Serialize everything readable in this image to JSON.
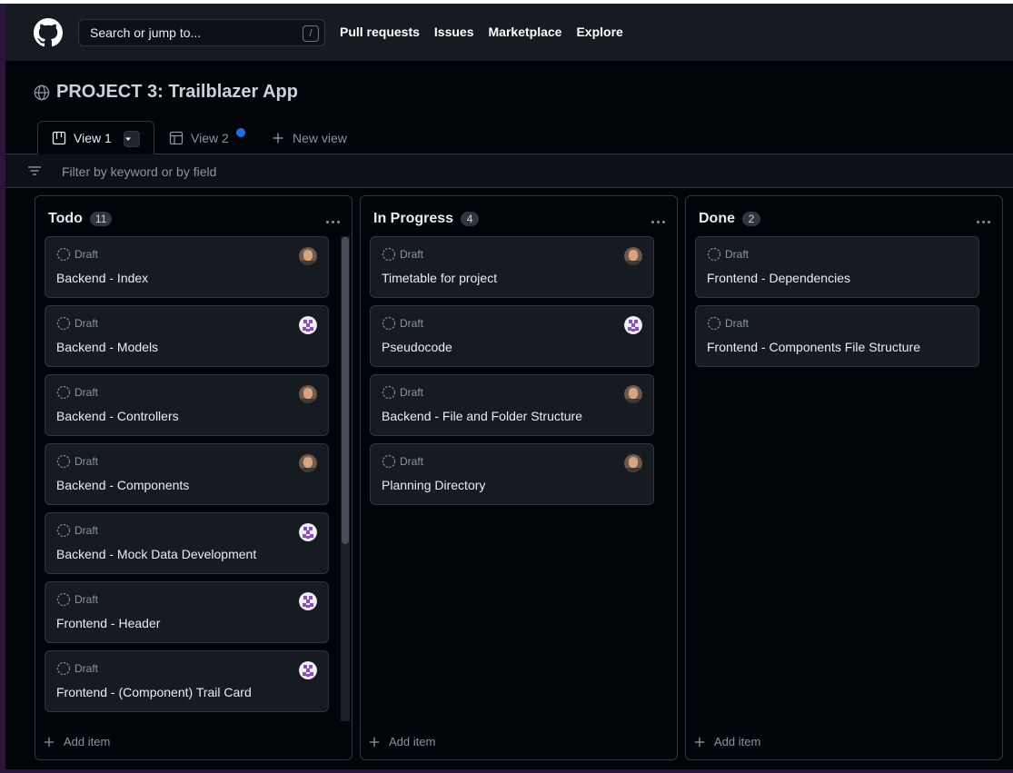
{
  "header": {
    "search_placeholder": "Search or jump to...",
    "search_key": "/",
    "nav": [
      "Pull requests",
      "Issues",
      "Marketplace",
      "Explore"
    ]
  },
  "project": {
    "title": "PROJECT 3: Trailblazer App"
  },
  "tabs": {
    "view1": "View 1",
    "view2": "View 2",
    "new_view": "New view"
  },
  "filter": {
    "placeholder": "Filter by keyword or by field"
  },
  "columns": [
    {
      "title": "Todo",
      "count": "11",
      "cards": [
        {
          "status": "Draft",
          "title": "Backend - Index",
          "avatar": "photo"
        },
        {
          "status": "Draft",
          "title": "Backend - Models",
          "avatar": "identicon"
        },
        {
          "status": "Draft",
          "title": "Backend - Controllers",
          "avatar": "photo"
        },
        {
          "status": "Draft",
          "title": "Backend - Components",
          "avatar": "photo"
        },
        {
          "status": "Draft",
          "title": "Backend - Mock Data Development",
          "avatar": "identicon"
        },
        {
          "status": "Draft",
          "title": "Frontend - Header",
          "avatar": "identicon"
        },
        {
          "status": "Draft",
          "title": "Frontend - (Component) Trail Card",
          "avatar": "identicon"
        }
      ],
      "add_label": "Add item"
    },
    {
      "title": "In Progress",
      "count": "4",
      "cards": [
        {
          "status": "Draft",
          "title": "Timetable for project",
          "avatar": "photo"
        },
        {
          "status": "Draft",
          "title": "Pseudocode",
          "avatar": "identicon"
        },
        {
          "status": "Draft",
          "title": "Backend - File and Folder Structure",
          "avatar": "photo"
        },
        {
          "status": "Draft",
          "title": "Planning Directory",
          "avatar": "photo"
        }
      ],
      "add_label": "Add item"
    },
    {
      "title": "Done",
      "count": "2",
      "cards": [
        {
          "status": "Draft",
          "title": "Frontend - Dependencies",
          "avatar": ""
        },
        {
          "status": "Draft",
          "title": "Frontend - Components File Structure",
          "avatar": ""
        }
      ],
      "add_label": "Add item"
    }
  ],
  "colors": {
    "accent": "#1f6feb",
    "bg": "#010409",
    "card": "#161b22",
    "border": "#30363d"
  }
}
